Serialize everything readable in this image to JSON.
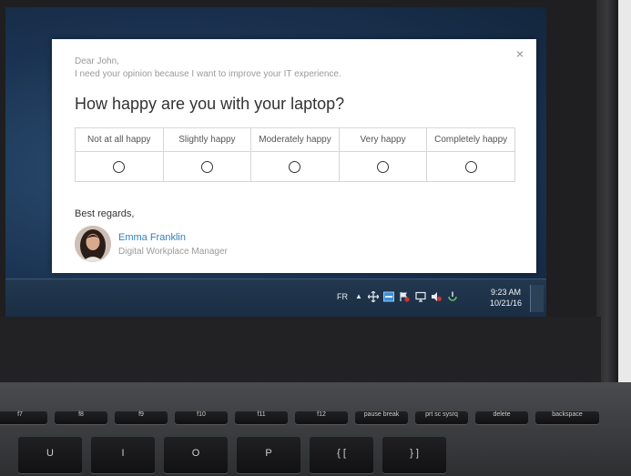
{
  "survey": {
    "greeting_line1": "Dear John,",
    "greeting_line2": "I need your opinion because I want to improve your IT experience.",
    "question": "How happy are you with your laptop?",
    "close_glyph": "×",
    "options": [
      {
        "label": "Not at all happy"
      },
      {
        "label": "Slightly happy"
      },
      {
        "label": "Moderately happy"
      },
      {
        "label": "Very happy"
      },
      {
        "label": "Completely happy"
      }
    ],
    "sign_off": "Best regards,",
    "sender_name": "Emma Franklin",
    "sender_title": "Digital Workplace Manager"
  },
  "taskbar": {
    "language": "FR",
    "overflow_glyph": "▲",
    "time": "9:23 AM",
    "date": "10/21/16",
    "tray_icons": [
      "move-icon",
      "network-icon",
      "flag-alert-icon",
      "monitor-icon",
      "volume-mute-icon",
      "power-icon"
    ]
  },
  "keyboard": {
    "keys": [
      "f7",
      "f8",
      "f9",
      "f10",
      "f11",
      "f12",
      "pause break",
      "prt sc sysrq",
      "delete",
      "backspace",
      "U",
      "I",
      "O",
      "P",
      "{ [",
      "} ]"
    ]
  },
  "colors": {
    "link": "#2f7fc1",
    "taskbar": "#1f344b",
    "desktop": "#1b3352"
  }
}
